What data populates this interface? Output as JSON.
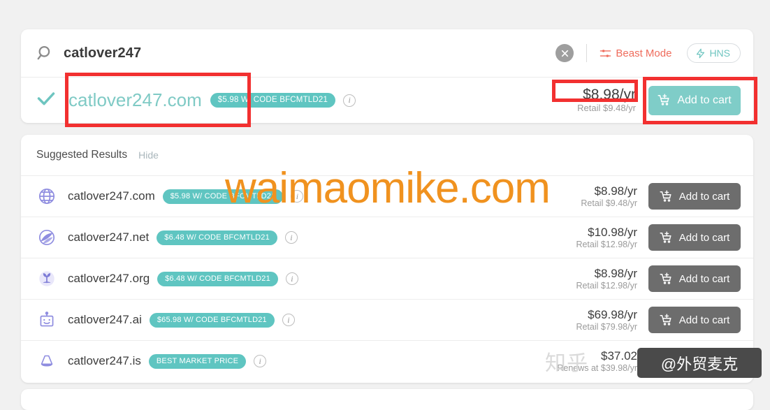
{
  "search": {
    "icon": "search-icon",
    "query": "catlover247",
    "clear_icon": "close-icon",
    "beast_mode_label": "Beast Mode",
    "beast_mode_icon": "sliders-icon",
    "beast_mode_color": "#ef6c5c",
    "hns_label": "HNS",
    "hns_icon": "lightning-bolt-icon",
    "hns_color": "#6ec5c0"
  },
  "exact_result": {
    "status_icon": "check-icon",
    "domain": "catlover247.com",
    "domain_color": "#7fcac5",
    "promo_badge": "$5.98 W/ CODE BFCMTLD21",
    "info_icon": "info-icon",
    "price": "$8.98/yr",
    "retail": "Retail $9.48/yr",
    "cart_label": "Add to cart",
    "cart_icon": "cart-plus-icon",
    "cart_color": "#7fcdc8"
  },
  "suggested": {
    "title": "Suggested Results",
    "hide_label": "Hide",
    "cart_label": "Add to cart",
    "cart_icon": "cart-plus-icon",
    "cart_color": "#6d6d6d",
    "rows": [
      {
        "icon": "globe-icon",
        "domain": "catlover247.com",
        "badge": "$5.98 W/ CODE BFCMTLD21",
        "price": "$8.98/yr",
        "sub": "Retail $9.48/yr"
      },
      {
        "icon": "net-swirl-icon",
        "domain": "catlover247.net",
        "badge": "$6.48 W/ CODE BFCMTLD21",
        "price": "$10.98/yr",
        "sub": "Retail $12.98/yr"
      },
      {
        "icon": "sprout-icon",
        "domain": "catlover247.org",
        "badge": "$6.48 W/ CODE BFCMTLD21",
        "price": "$8.98/yr",
        "sub": "Retail $12.98/yr"
      },
      {
        "icon": "robot-icon",
        "domain": "catlover247.ai",
        "badge": "$65.98 W/ CODE BFCMTLD21",
        "price": "$69.98/yr",
        "sub": "Retail $79.98/yr"
      },
      {
        "icon": "volcano-icon",
        "domain": "catlover247.is",
        "badge": "BEST MARKET PRICE",
        "price": "$37.02",
        "sub": "Renews at $39.98/yr"
      }
    ]
  },
  "watermarks": {
    "main": "waimaomike.com",
    "main_color": "#f0921f",
    "zhihu": "知乎",
    "handle": "@外贸麦克"
  },
  "annotations": {
    "highlight_color": "#f23030",
    "boxes": [
      "domain-name",
      "price",
      "add-to-cart-button"
    ]
  }
}
